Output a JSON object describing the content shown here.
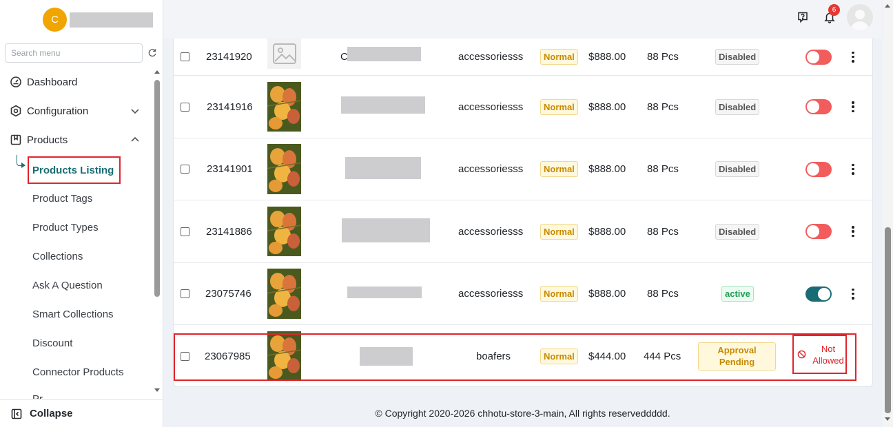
{
  "sidebar": {
    "brand_initial": "C",
    "search_placeholder": "Search menu",
    "nav": {
      "dashboard": "Dashboard",
      "configuration": "Configuration",
      "products": "Products"
    },
    "products_submenu": {
      "active": "Products Listing",
      "items": [
        "Product Tags",
        "Product Types",
        "Collections",
        "Ask A Question",
        "Smart Collections",
        "Discount",
        "Connector Products",
        "Pr"
      ]
    },
    "collapse_label": "Collapse"
  },
  "header": {
    "notification_count": "6"
  },
  "table": {
    "rows": [
      {
        "id": "23141920",
        "image": "placeholder-image-icon",
        "name_visible": "C",
        "category": "accessoriesss",
        "type": "Normal",
        "price": "$888.00",
        "stock": "88 Pcs",
        "status": "Disabled",
        "toggle": "off"
      },
      {
        "id": "23141916",
        "image": "mango-photo",
        "name_visible": "",
        "category": "accessoriesss",
        "type": "Normal",
        "price": "$888.00",
        "stock": "88 Pcs",
        "status": "Disabled",
        "toggle": "off"
      },
      {
        "id": "23141901",
        "image": "mango-photo",
        "name_visible": "",
        "category": "accessoriesss",
        "type": "Normal",
        "price": "$888.00",
        "stock": "88 Pcs",
        "status": "Disabled",
        "toggle": "off"
      },
      {
        "id": "23141886",
        "image": "mango-photo",
        "name_visible": "",
        "category": "accessoriesss",
        "type": "Normal",
        "price": "$888.00",
        "stock": "88 Pcs",
        "status": "Disabled",
        "toggle": "off"
      },
      {
        "id": "23075746",
        "image": "mango-photo",
        "name_visible": "",
        "category": "accessoriesss",
        "type": "Normal",
        "price": "$888.00",
        "stock": "88 Pcs",
        "status": "active",
        "toggle": "on"
      },
      {
        "id": "23067985",
        "image": "mango-photo",
        "name_visible": "",
        "category": "boafers",
        "type": "Normal",
        "price": "$444.00",
        "stock": "444 Pcs",
        "status": "Approval Pending",
        "action": "Not Allowed"
      }
    ]
  },
  "footer": {
    "copyright": "© Copyright 2020-2026 chhotu-store-3-main, All rights reserveddddd."
  },
  "colors": {
    "accent": "#1a6c74",
    "highlight": "#e0242b",
    "brand_avatar": "#f0a500",
    "toggle_off": "#f25c5c"
  }
}
